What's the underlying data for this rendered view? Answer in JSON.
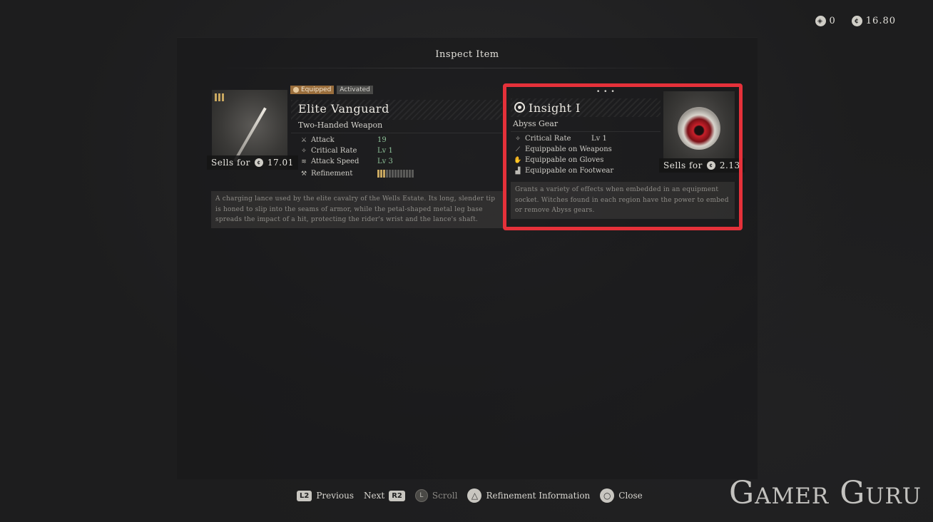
{
  "currency": [
    {
      "icon": "seal-icon",
      "value": "0"
    },
    {
      "icon": "coin-icon",
      "value": "16.80"
    }
  ],
  "panel": {
    "title": "Inspect Item"
  },
  "weapon": {
    "badges": {
      "equipped": "Equipped",
      "activated": "Activated"
    },
    "name": "Elite Vanguard",
    "type": "Two-Handed Weapon",
    "sells_label": "Sells for",
    "sells_value": "17.01",
    "stats": [
      {
        "icon": "sword-icon",
        "label": "Attack",
        "value": "19"
      },
      {
        "icon": "crit-icon",
        "label": "Critical Rate",
        "value": "Lv 1"
      },
      {
        "icon": "speed-icon",
        "label": "Attack Speed",
        "value": "Lv 3"
      }
    ],
    "refinement_label": "Refinement",
    "refinement_level": 3,
    "refinement_max": 13,
    "description": "A charging lance used by the elite cavalry of the Wells Estate. Its long, slender tip is honed to slip into the seams of armor, while the petal-shaped metal leg base spreads the impact of a hit, protecting the rider's wrist and the lance's shaft."
  },
  "abyss_gear": {
    "name": "Insight Ⅰ",
    "type": "Abyss Gear",
    "sells_label": "Sells for",
    "sells_value": "2.13",
    "stat": {
      "label": "Critical Rate",
      "value": "Lv 1"
    },
    "equippable": [
      {
        "icon": "weapon-icon",
        "text": "Equippable on Weapons"
      },
      {
        "icon": "gloves-icon",
        "text": "Equippable on Gloves"
      },
      {
        "icon": "footwear-icon",
        "text": "Equippable on Footwear"
      }
    ],
    "description": "Grants a variety of effects when embedded in an equipment socket. Witches found in each region have the power to embed or remove Abyss gears."
  },
  "footer": {
    "previous": {
      "key": "L2",
      "label": "Previous"
    },
    "next": {
      "key": "R2",
      "label": "Next"
    },
    "scroll": {
      "key": "L",
      "label": "Scroll"
    },
    "refinement": {
      "label": "Refinement Information"
    },
    "close": {
      "label": "Close"
    }
  },
  "watermark": "Gamer Guru",
  "colors": {
    "highlight": "#e5313a",
    "stat_value": "#8fc49a",
    "accent_gold": "#c9a860"
  }
}
